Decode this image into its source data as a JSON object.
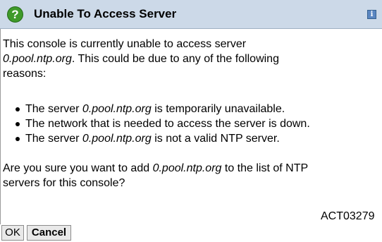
{
  "dialog": {
    "title": "Unable To Access Server",
    "title_icon": "question-icon",
    "help_icon": "info-icon",
    "header_color": "#ccd9e8"
  },
  "message": {
    "intro_line1": "This console is currently unable to access server",
    "intro_server": "0.pool.ntp.org",
    "intro_line2_rest": ". This could be due to any of the following",
    "intro_line3": "reasons:",
    "reasons": [
      {
        "prefix": "The server ",
        "server": "0.pool.ntp.org",
        "suffix": " is temporarily unavailable."
      },
      {
        "prefix": "The network that is needed to access the server is down.",
        "server": "",
        "suffix": ""
      },
      {
        "prefix": "The server ",
        "server": "0.pool.ntp.org",
        "suffix": " is not a valid NTP server."
      }
    ],
    "question_prefix": "Are you sure you want to add ",
    "question_server": "0.pool.ntp.org",
    "question_suffix": " to the list of NTP",
    "question_line2": "servers for this console?",
    "message_id": "ACT03279"
  },
  "buttons": {
    "ok_label": "OK",
    "cancel_label": "Cancel"
  }
}
